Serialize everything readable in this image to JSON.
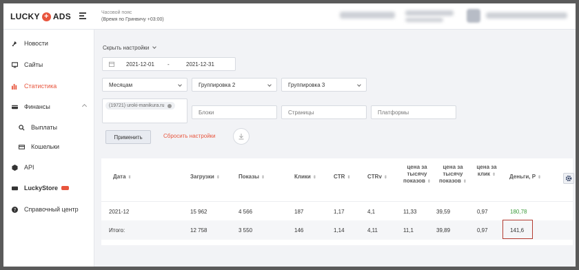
{
  "brand": {
    "part1": "LUCKY",
    "part2": "ADS",
    "accent": "#e8553d"
  },
  "timezone": {
    "label": "Часовой пояс",
    "value": "(Время по Гринвичу +03:00)"
  },
  "sidebar": {
    "items": [
      {
        "label": "Новости",
        "icon": "rocket-icon"
      },
      {
        "label": "Сайты",
        "icon": "monitor-icon"
      },
      {
        "label": "Статистика",
        "icon": "bar-chart-icon"
      },
      {
        "label": "Финансы",
        "icon": "wallet-icon"
      },
      {
        "label": "Выплаты",
        "icon": "search-icon"
      },
      {
        "label": "Кошельки",
        "icon": "card-icon"
      },
      {
        "label": "API",
        "icon": "api-icon"
      },
      {
        "label": "LuckyStore",
        "icon": "store-icon"
      },
      {
        "label": "Справочный центр",
        "icon": "help-icon"
      }
    ]
  },
  "filters": {
    "settings_link": "Скрыть настройки",
    "date_from": "2021-12-01",
    "date_sep": "-",
    "date_to": "2021-12-31",
    "period": "Месяцам",
    "group2": "Группировка 2",
    "group3": "Группировка 3",
    "site_tag": "(19721) uroki-manikura.ru",
    "blocks_placeholder": "Блоки",
    "pages_placeholder": "Страницы",
    "platforms_placeholder": "Платформы",
    "apply_label": "Применить",
    "reset_label": "Сбросить настройки"
  },
  "table": {
    "headers": [
      "Дата",
      "Загрузки",
      "Показы",
      "Клики",
      "CTR",
      "CTRv",
      "цена за тысячу показов",
      "цена за тысячу показов",
      "цена за клик",
      "Деньги, Р"
    ],
    "rows": [
      [
        "2021-12",
        "15 962",
        "4 566",
        "187",
        "1,17",
        "4,1",
        "11,33",
        "39,59",
        "0,97",
        "180,78"
      ],
      [
        "Итого:",
        "12 758",
        "3 550",
        "146",
        "1,14",
        "4,11",
        "11,1",
        "39,89",
        "0,97",
        "141,6"
      ]
    ]
  }
}
